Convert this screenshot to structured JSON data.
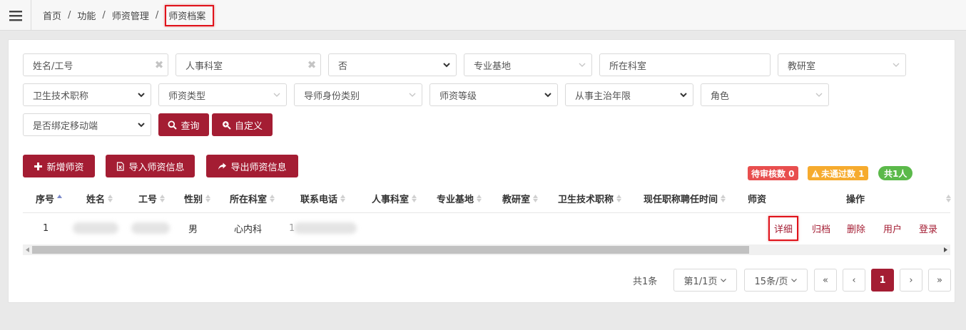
{
  "breadcrumb": {
    "items": [
      "首页",
      "功能",
      "师资管理"
    ],
    "current": "师资档案",
    "separator": "/"
  },
  "filters": {
    "name_id": {
      "placeholder": "姓名/工号"
    },
    "hr_dept": {
      "value": "人事科室"
    },
    "yes_no": {
      "value": "否"
    },
    "base": {
      "value": "专业基地"
    },
    "dept": {
      "value": "所在科室"
    },
    "teaching_office": {
      "value": "教研室"
    },
    "title": {
      "value": "卫生技术职称"
    },
    "teacher_type": {
      "value": "师资类型"
    },
    "mentor_type": {
      "value": "导师身份类别"
    },
    "teacher_level": {
      "value": "师资等级"
    },
    "years": {
      "value": "从事主治年限"
    },
    "role": {
      "value": "角色"
    },
    "mobile": {
      "value": "是否绑定移动端"
    }
  },
  "buttons": {
    "query": "查询",
    "custom": "自定义",
    "add": "新增师资",
    "import": "导入师资信息",
    "export": "导出师资信息"
  },
  "badges": {
    "pending": "待审核数 0",
    "failed": "未通过数 1",
    "total": "共1人"
  },
  "table": {
    "columns": [
      "序号",
      "姓名",
      "工号",
      "性别",
      "所在科室",
      "联系电话",
      "人事科室",
      "专业基地",
      "教研室",
      "卫生技术职称",
      "现任职称聘任时间",
      "师资",
      "操作"
    ],
    "rows": [
      {
        "index": "1",
        "gender": "男",
        "dept": "心内科",
        "phone_prefix": "1"
      }
    ],
    "actions": [
      "详细",
      "归档",
      "删除",
      "用户",
      "登录"
    ]
  },
  "pagination": {
    "total": "共1条",
    "page": "第1/1页",
    "page_size": "15条/页",
    "first": "«",
    "prev": "‹",
    "current": "1",
    "next": "›",
    "last": "»"
  },
  "colors": {
    "primary": "#a41d33",
    "badge_red": "#e84e4e",
    "badge_orange": "#f6ab2e",
    "badge_green": "#5bb94a"
  }
}
